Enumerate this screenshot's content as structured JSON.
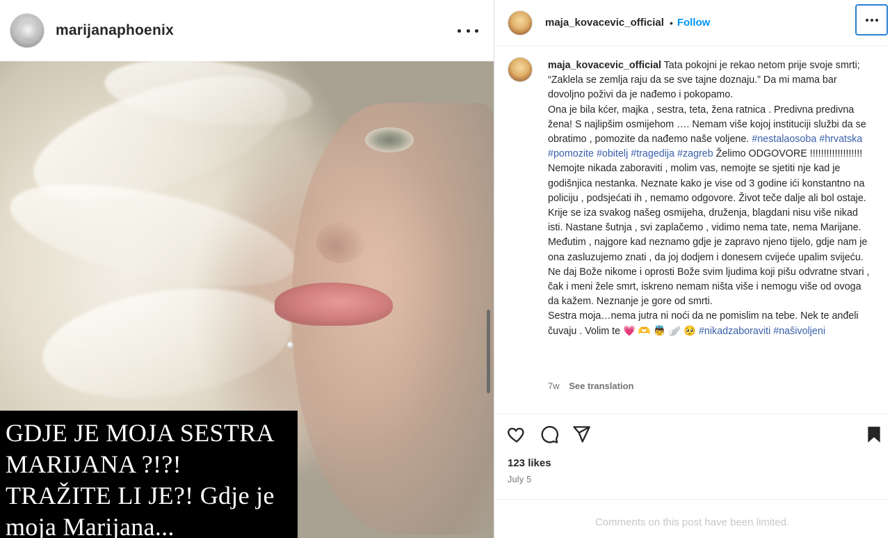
{
  "post_author": {
    "username": "marijanaphoenix",
    "avatar_icon": "profile-avatar",
    "more_icon": "more-horizontal-icon"
  },
  "image": {
    "caption_lines": [
      "GDJE JE MOJA SESTRA",
      "MARIJANA ?!?!",
      "TRAŽITE LI JE?! Gdje je",
      "moja Marijana..."
    ]
  },
  "header": {
    "username": "maja_kovacevic_official",
    "separator": "•",
    "follow_label": "Follow",
    "more_icon": "more-horizontal-icon"
  },
  "caption": {
    "username": "maja_kovacevic_official",
    "text_1": " Tata pokojni je rekao netom prije svoje smrti; “Zaklela se zemlja raju da se sve tajne doznaju.” Da mi mama bar dovoljno poživi da je nađemo i pokopamo.",
    "text_2": "Ona je bila kćer, majka , sestra, teta, žena ratnica . Predivna predivna žena! S najlipšim osmijehom …. Nemam više kojoj instituciji službi da se obratimo , pomozite da nađemo naše voljene. ",
    "hashtags_1": [
      "#nestalaosoba",
      "#hrvatska",
      "#pomozite",
      "#obitelj",
      "#tragedija",
      "#zagreb"
    ],
    "text_3": " Želimo ODGOVORE !!!!!!!!!!!!!!!!!!!",
    "text_4": "Nemojte nikada zaboraviti , molim vas, nemojte se sjetiti nje kad je godišnjica nestanka. Neznate kako je vise od 3 godine ići konstantno na policiju , podsjećati ih , nemamo odgovore. Život teče dalje ali bol ostaje. Krije se iza svakog našeg osmijeha, druženja, blagdani nisu više nikad isti. Nastane šutnja , svi zaplačemo , vidimo nema tate, nema Marijane. Međutim , najgore kad neznamo gdje je zapravo njeno tijelo, gdje nam je ona zasluzujemo znati , da joj dodjem i donesem cvijeće upalim svijeću. Ne daj Bože nikome i oprosti Bože svim ljudima koji pišu odvratne stvari , čak i meni žele smrt, iskreno nemam ništa više i nemogu više od ovoga da kažem. Neznanje je gore od smrti.",
    "text_5": "Sestra moja…nema jutra ni noći da ne pomislim na tebe. Nek te anđeli čuvaju . Volim te ",
    "emojis": "💗 🫶 👼 🪽 🥺",
    "hashtags_2": [
      "#nikadzaboraviti",
      "#naŝivoljeni"
    ],
    "age": "7w",
    "translate_label": "See translation"
  },
  "actions": {
    "like_icon": "heart-icon",
    "comment_icon": "comment-icon",
    "share_icon": "send-icon",
    "save_icon": "bookmark-icon"
  },
  "likes": "123 likes",
  "date": "July 5",
  "comments_notice": "Comments on this post have been limited.",
  "colors": {
    "link_blue": "#0095f6",
    "hashtag": "#385fa9",
    "muted": "#737373",
    "focus_ring": "#2a7fd4"
  }
}
